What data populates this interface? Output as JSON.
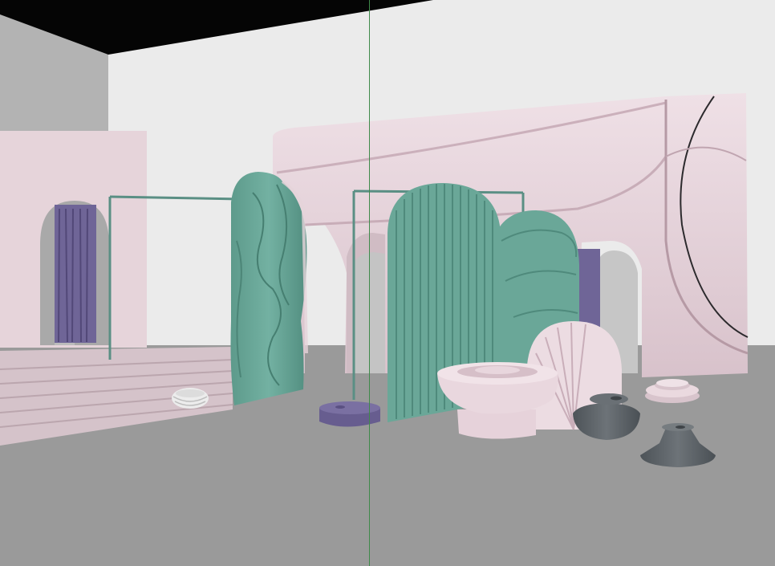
{
  "viewport": {
    "projection": "perspective",
    "render_mode": "clay-shaded",
    "guide_axis": "vertical"
  },
  "colors": {
    "background_ceiling": "#050505",
    "back_wall": "#ebebeb",
    "left_wall": "#b3b3b3",
    "floor": "#9a9a9a",
    "blush_pink": "#e8d6dd",
    "blush_pink_shadow": "#cdb3bd",
    "mint_green": "#6aa798",
    "mint_green_dark": "#4f8a7c",
    "lavender": "#6f6597",
    "slate_gray": "#5e6469",
    "guide_line": "#3f8a4a",
    "rail": "#5a8f84"
  },
  "scene_objects": [
    {
      "name": "left-room-partition",
      "material": "blush_pink"
    },
    {
      "name": "left-arch-doorway",
      "material": "blush_pink"
    },
    {
      "name": "purple-curtain",
      "material": "lavender"
    },
    {
      "name": "stepped-platform",
      "material": "blush_pink"
    },
    {
      "name": "clothing-rail-left",
      "material": "mint_green"
    },
    {
      "name": "clothing-rail-center",
      "material": "mint_green"
    },
    {
      "name": "puffy-wall-backdrop",
      "material": "blush_pink"
    },
    {
      "name": "puffy-green-screen",
      "material": "mint_green"
    },
    {
      "name": "fluted-green-arch",
      "material": "mint_green"
    },
    {
      "name": "quilted-green-arch",
      "material": "mint_green"
    },
    {
      "name": "fan-shell-panel",
      "material": "blush_pink"
    },
    {
      "name": "pedestal-bowl",
      "material": "blush_pink"
    },
    {
      "name": "stacked-rings",
      "material": "blush_pink"
    },
    {
      "name": "dark-bowl",
      "material": "slate_gray"
    },
    {
      "name": "dark-candle-base",
      "material": "slate_gray"
    },
    {
      "name": "purple-cushion-pouf",
      "material": "lavender"
    },
    {
      "name": "small-white-bowl",
      "material": "blush_pink"
    }
  ]
}
